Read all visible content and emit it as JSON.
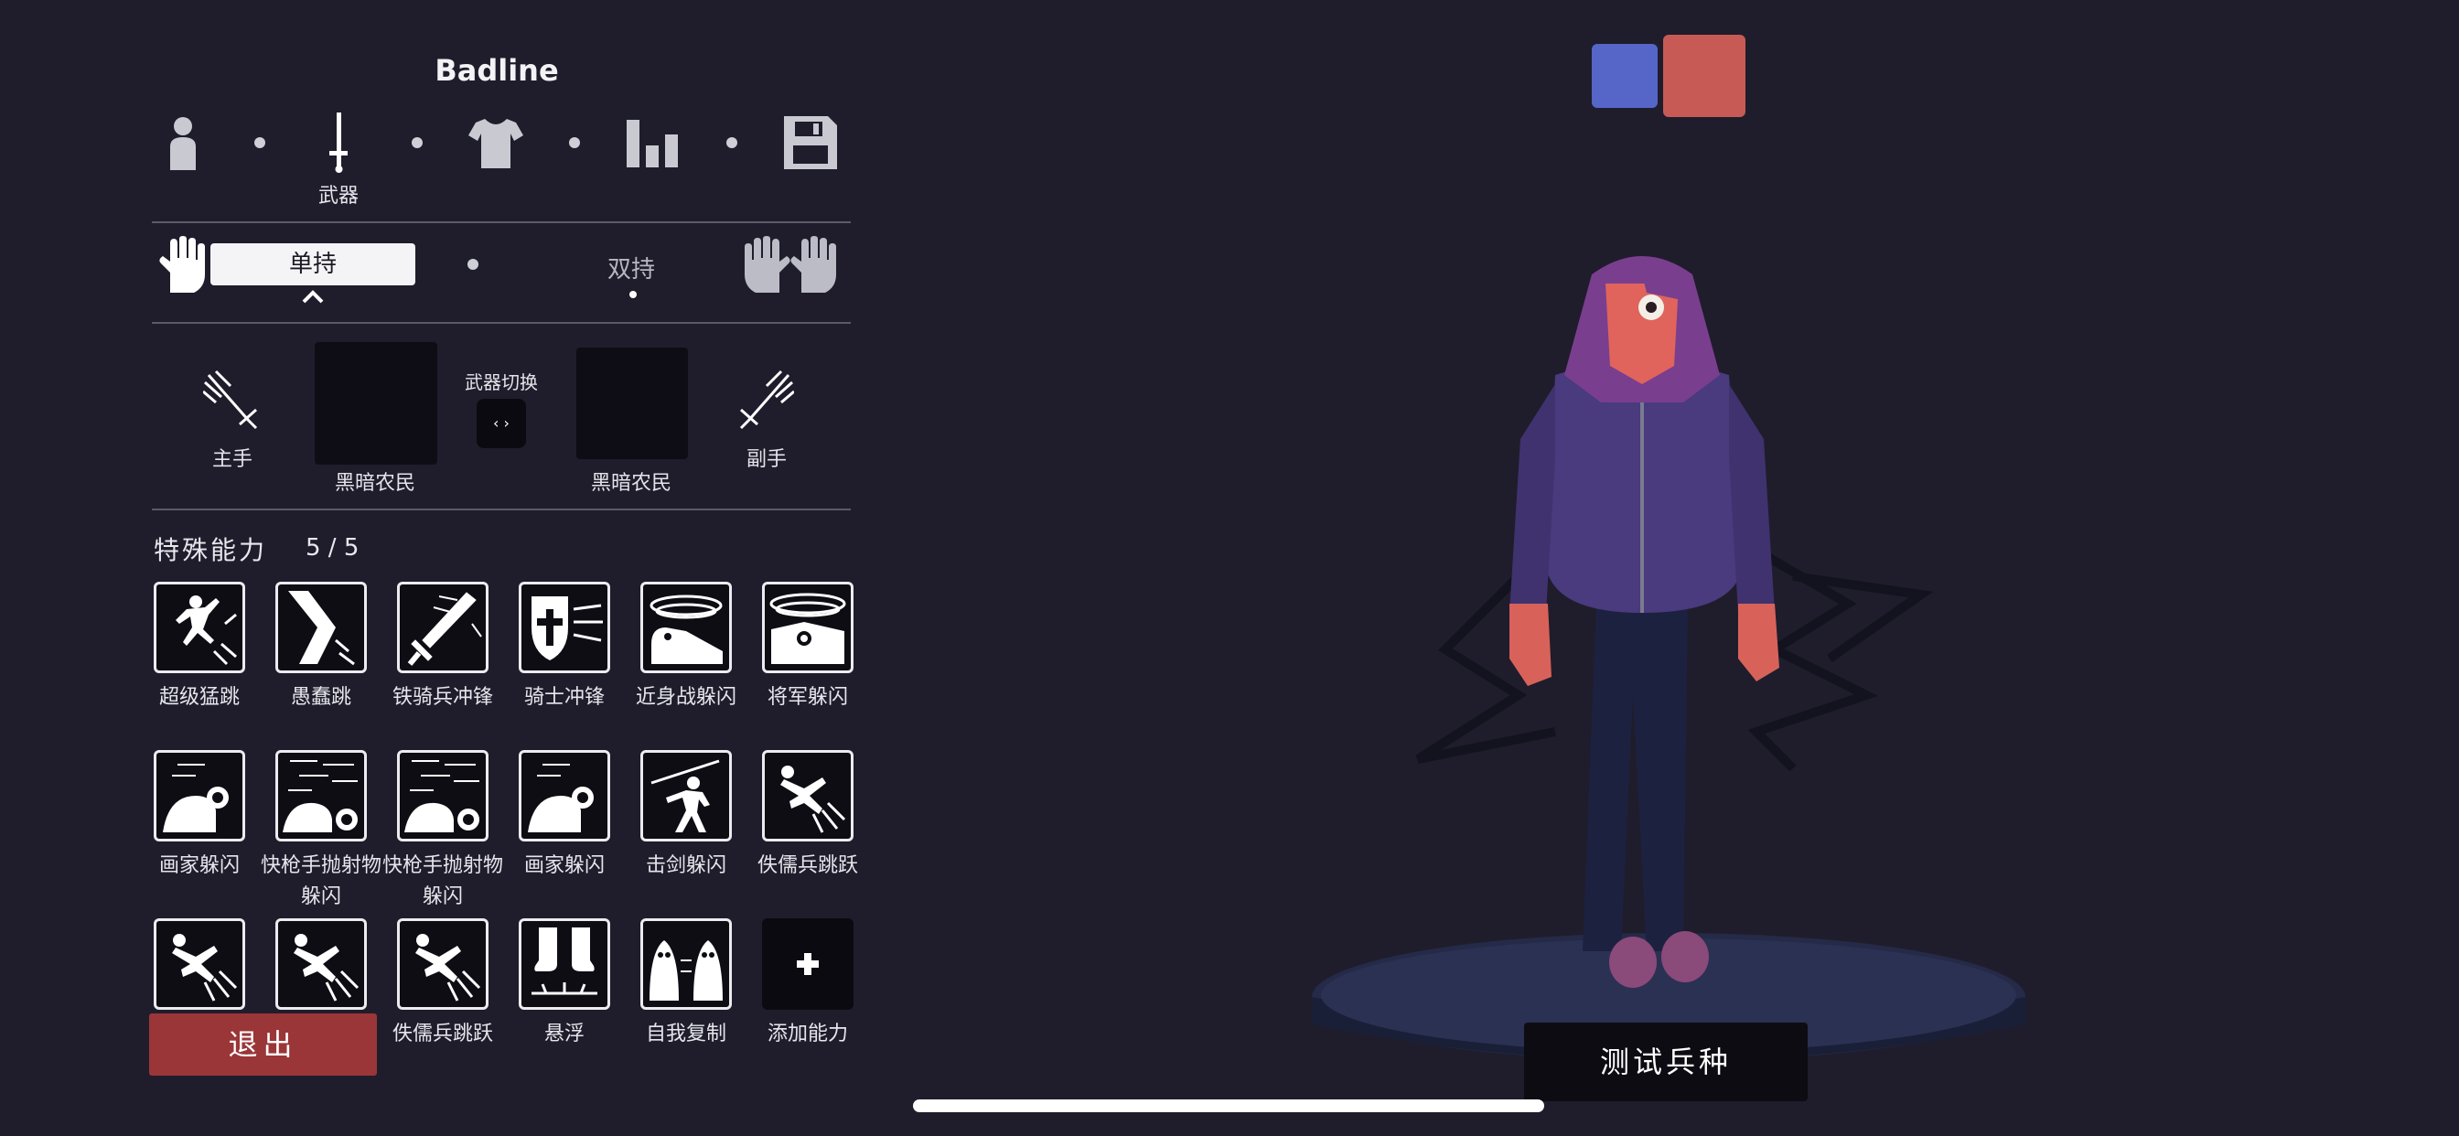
{
  "unit_name": "Badline",
  "steps": {
    "active_label": "武器",
    "icons": [
      "person-icon",
      "sword-icon",
      "shirt-icon",
      "stats-icon",
      "save-icon"
    ]
  },
  "hand_mode": {
    "single_label": "单持",
    "dual_label": "双持"
  },
  "weapons": {
    "main_hand_label": "主手",
    "off_hand_label": "副手",
    "main_weapon_name": "黑暗农民",
    "off_weapon_name": "黑暗农民",
    "switch_label": "武器切换",
    "switch_glyph": "‹ ›"
  },
  "abilities": {
    "header": "特殊能力",
    "count": "5 / 5",
    "items": [
      {
        "label": "超级猛跳",
        "icon": "leap-icon"
      },
      {
        "label": "愚蠢跳",
        "icon": "leg-jump-icon"
      },
      {
        "label": "铁骑兵冲锋",
        "icon": "sword-charge-icon"
      },
      {
        "label": "骑士冲锋",
        "icon": "shield-charge-icon"
      },
      {
        "label": "近身战躲闪",
        "icon": "melee-dodge-icon"
      },
      {
        "label": "将军躲闪",
        "icon": "general-dodge-icon"
      },
      {
        "label": "画家躲闪",
        "icon": "painter-dodge-icon"
      },
      {
        "label": "快枪手抛射物躲闪",
        "icon": "gunslinger-dodge-icon"
      },
      {
        "label": "快枪手抛射物躲闪",
        "icon": "gunslinger-dodge-icon"
      },
      {
        "label": "画家躲闪",
        "icon": "painter-dodge-icon"
      },
      {
        "label": "击剑躲闪",
        "icon": "fencer-dodge-icon"
      },
      {
        "label": "佚儒兵跳跃",
        "icon": "mercenary-jump-icon"
      },
      {
        "label": "",
        "icon": "mercenary-jump-icon"
      },
      {
        "label": "",
        "icon": "mercenary-jump-icon"
      },
      {
        "label": "佚儒兵跳跃",
        "icon": "mercenary-jump-icon"
      },
      {
        "label": "悬浮",
        "icon": "levitate-icon"
      },
      {
        "label": "自我复制",
        "icon": "self-clone-icon"
      },
      {
        "label": "添加能力",
        "icon": "plus-icon"
      }
    ]
  },
  "buttons": {
    "exit": "退出",
    "test_unit": "测试兵种"
  },
  "team_colors": [
    "#5566c8",
    "#c85a55"
  ]
}
